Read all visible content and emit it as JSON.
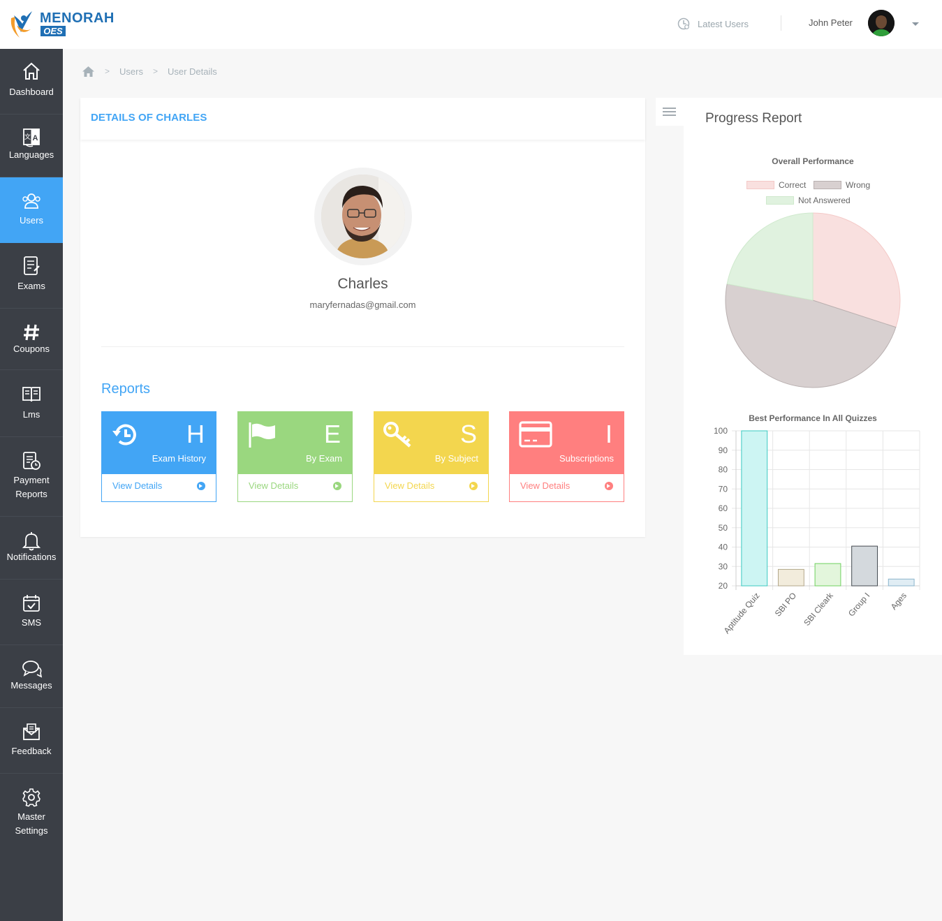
{
  "header": {
    "brand": "MENORAH",
    "brand_sub": "OES",
    "latest_users": "Latest Users",
    "user_name": "John Peter"
  },
  "sidebar": {
    "items": [
      {
        "label": "Dashboard",
        "icon": "home-icon"
      },
      {
        "label": "Languages",
        "icon": "language-icon"
      },
      {
        "label": "Users",
        "icon": "users-icon",
        "active": true
      },
      {
        "label": "Exams",
        "icon": "exams-icon"
      },
      {
        "label": "Coupons",
        "icon": "hashtag-icon"
      },
      {
        "label": "Lms",
        "icon": "book-icon"
      },
      {
        "label": "Payment Reports",
        "lines": [
          "Payment",
          "Reports"
        ],
        "icon": "payment-reports-icon"
      },
      {
        "label": "Notifications",
        "icon": "bell-icon"
      },
      {
        "label": "SMS",
        "icon": "calendar-check-icon"
      },
      {
        "label": "Messages",
        "icon": "chat-icon"
      },
      {
        "label": "Feedback",
        "icon": "envelope-icon"
      },
      {
        "label": "Master Settings",
        "lines": [
          "Master",
          "Settings"
        ],
        "icon": "gear-icon"
      }
    ]
  },
  "breadcrumb": {
    "items": [
      "Users",
      "User Details"
    ],
    "separator": ">"
  },
  "details": {
    "title": "DETAILS OF CHARLES",
    "name": "Charles",
    "email": "maryfernadas@gmail.com",
    "reports_title": "Reports",
    "tiles": [
      {
        "letter": "H",
        "label": "Exam History",
        "link": "View Details",
        "color": "#42a5f5",
        "icon": "history-icon"
      },
      {
        "letter": "E",
        "label": "By Exam",
        "link": "View Details",
        "color": "#9ad77f",
        "icon": "flag-icon"
      },
      {
        "letter": "S",
        "label": "By Subject",
        "link": "View Details",
        "color": "#f3d64e",
        "icon": "key-icon"
      },
      {
        "letter": "I",
        "label": "Subscriptions",
        "link": "View Details",
        "color": "#ff7f7f",
        "icon": "credit-card-icon"
      }
    ]
  },
  "progress": {
    "title": "Progress Report"
  },
  "chart_data": [
    {
      "type": "pie",
      "title": "Overall Performance",
      "labels": [
        "Correct",
        "Wrong",
        "Not Answered"
      ],
      "values": [
        30,
        48,
        22
      ],
      "colors": [
        "#f9e0df",
        "#d8d0d0",
        "#e0f2df"
      ],
      "border_colors": [
        "#f4c9c7",
        "#b9b0b0",
        "#cfe9cd"
      ],
      "legend": "top"
    },
    {
      "type": "bar",
      "title": "Best Performance In All Quizzes",
      "categories": [
        "Aptitude Quiz",
        "SBI PO",
        "SBI Cleark",
        "Group I",
        "Ages"
      ],
      "values": [
        100,
        28.5,
        31.5,
        40.5,
        23.5
      ],
      "colors": [
        "#cdf5f3",
        "#f2ecdc",
        "#e3f6dc",
        "#d4d9dd",
        "#e0edf4"
      ],
      "border_colors": [
        "#3cc9c1",
        "#b3a78a",
        "#6fd15e",
        "#444a50",
        "#8bb4cc"
      ],
      "ylim": [
        20,
        100
      ],
      "yticks": [
        20,
        30,
        40,
        50,
        60,
        70,
        80,
        90,
        100
      ],
      "grid": true
    }
  ]
}
